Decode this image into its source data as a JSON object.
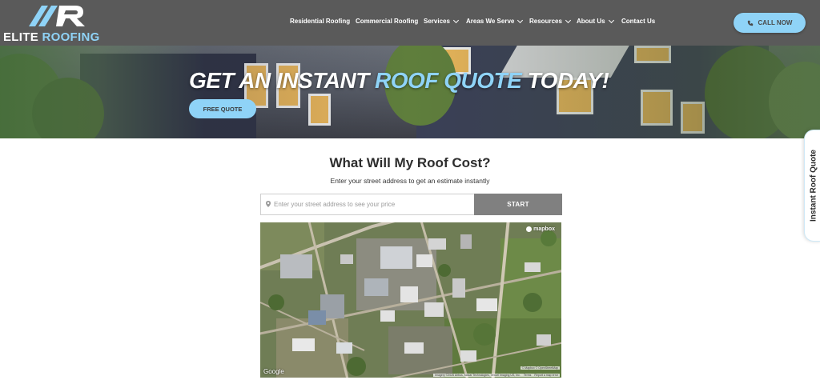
{
  "header": {
    "logo_word_1": "ELITE",
    "logo_word_2": "ROOFING",
    "nav": [
      {
        "label": "Residential Roofing",
        "dropdown": false
      },
      {
        "label": "Commercial Roofing",
        "dropdown": false
      },
      {
        "label": "Services",
        "dropdown": true
      },
      {
        "label": "Areas We Serve",
        "dropdown": true
      },
      {
        "label": "Resources",
        "dropdown": true
      },
      {
        "label": "About Us",
        "dropdown": true
      },
      {
        "label": "Contact Us",
        "dropdown": false
      }
    ],
    "call_label": "CALL NOW",
    "call_icon": "phone-icon"
  },
  "hero": {
    "title_part1": "GET AN INSTANT",
    "title_accent": "ROOF QUOTE",
    "title_part2": "TODAY!",
    "cta_label": "FREE QUOTE"
  },
  "estimator": {
    "title": "What Will My Roof Cost?",
    "subtitle": "Enter your street address to get an estimate instantly",
    "input_placeholder": "Enter your street address to see your price",
    "input_value": "",
    "start_label": "START"
  },
  "map": {
    "provider_logo": "mapbox",
    "google_label": "Google",
    "attribution_top": "© Mapbox  © OpenStreetMap",
    "attribution_imagery": "Imagery ©2026 Airbus, Maxar Technologies, Vexcel Imaging US, Inc.",
    "attribution_terms": "Terms",
    "attribution_report": "Report a map error"
  },
  "side_tab": {
    "label": "Instant Roof Quote"
  },
  "colors": {
    "header_bg": "#5a5a5a",
    "accent": "#8fd3f7",
    "start_button": "#808080"
  }
}
